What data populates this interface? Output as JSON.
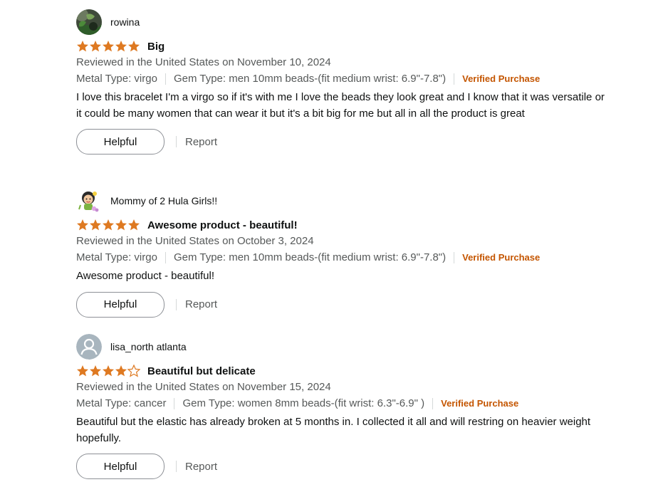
{
  "reviews": [
    {
      "name": "rowina",
      "rating": 5,
      "title": "Big",
      "date": "Reviewed in the United States on November 10, 2024",
      "metal": "Metal Type: virgo",
      "gem": "Gem Type: men 10mm beads-(fit medium wrist: 6.9\"-7.8\")",
      "verified": "Verified Purchase",
      "body": "I love this bracelet I'm a virgo so if it's with me I love the beads they look great and I know that it was versatile or it could be many women that can wear it but it's a bit big for me but all in all the product is great",
      "helpful": "Helpful",
      "report": "Report"
    },
    {
      "name": "Mommy of 2 Hula Girls!!",
      "rating": 5,
      "title": "Awesome product - beautiful!",
      "date": "Reviewed in the United States on October 3, 2024",
      "metal": "Metal Type: virgo",
      "gem": "Gem Type: men 10mm beads-(fit medium wrist: 6.9\"-7.8\")",
      "verified": "Verified Purchase",
      "body": "Awesome product - beautiful!",
      "helpful": "Helpful",
      "report": "Report"
    },
    {
      "name": "lisa_north atlanta",
      "rating": 4,
      "title": "Beautiful but delicate",
      "date": "Reviewed in the United States on November 15, 2024",
      "metal": "Metal Type: cancer",
      "gem": "Gem Type: women 8mm beads-(fit wrist: 6.3\"-6.9\" )",
      "verified": "Verified Purchase",
      "body": "Beautiful but the elastic has already broken at 5 months in. I collected it all and will restring on heavier weight hopefully.",
      "helpful": "Helpful",
      "report": "Report"
    }
  ],
  "colors": {
    "star": "#de7921",
    "verified": "#c45500",
    "secondary_text": "#565959",
    "primary_text": "#0f1111"
  },
  "icons": {
    "star_full": "star-full-icon",
    "star_empty": "star-empty-icon",
    "default_avatar": "person-icon"
  }
}
